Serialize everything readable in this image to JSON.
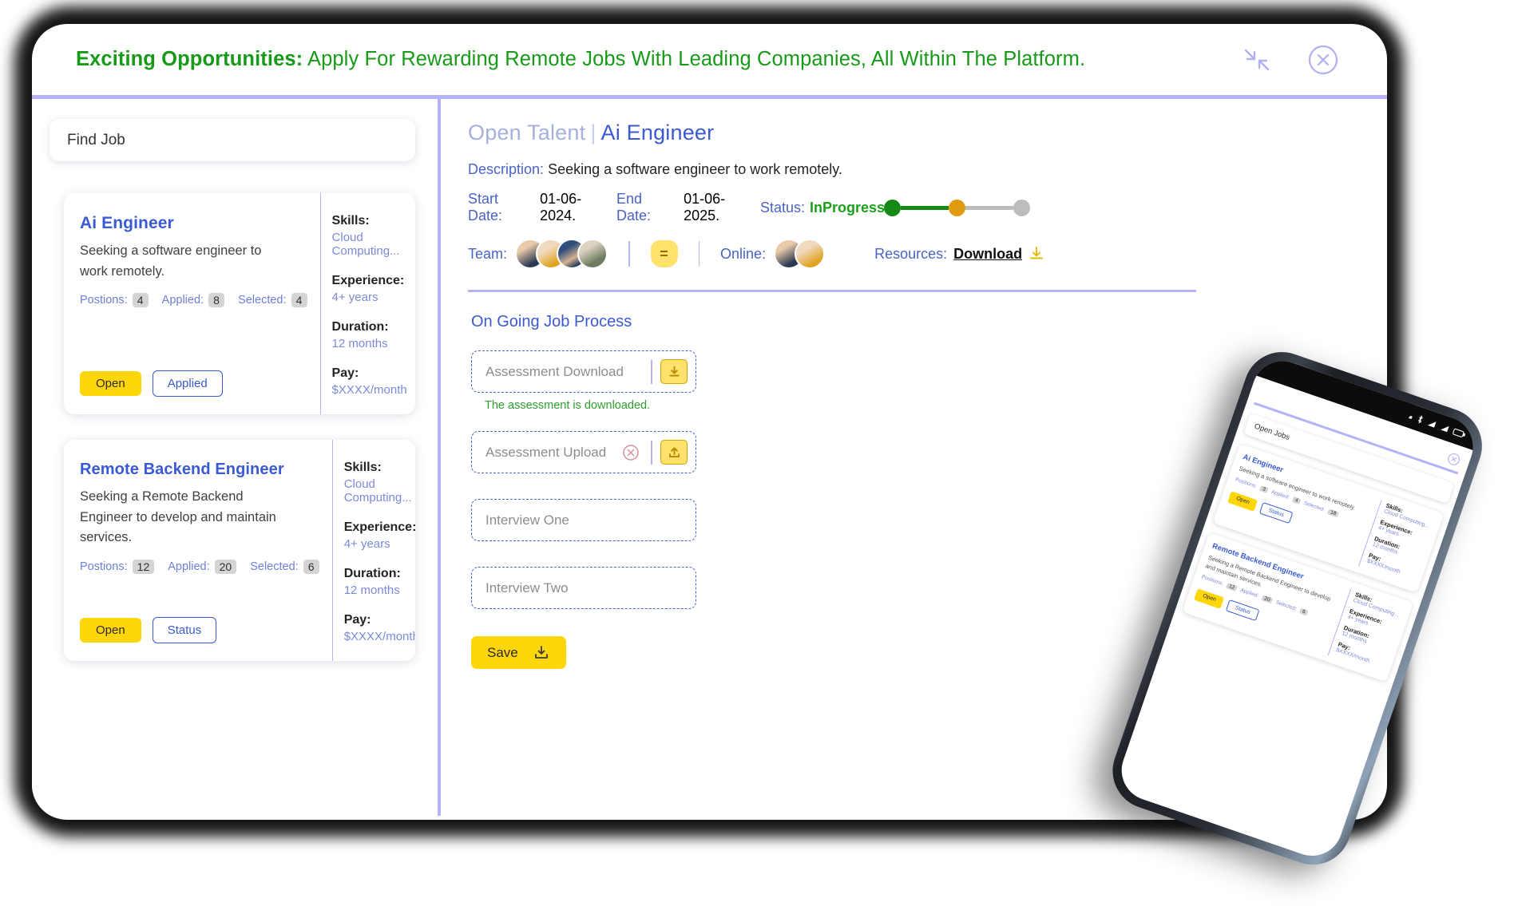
{
  "banner": {
    "title_bold": "Exciting Opportunities:",
    "title_rest": " Apply For Rewarding Remote Jobs With Leading Companies, All Within The Platform.",
    "accent_color": "#179a17",
    "minimize_icon": "collapse-arrows-icon",
    "close_icon": "close-circle-icon",
    "divider_color": "#b3b3f7"
  },
  "sidebar": {
    "search": {
      "value": "Find Job",
      "placeholder": "Find Job"
    },
    "labels": {
      "positions": "Postions:",
      "applied": "Applied:",
      "selected": "Selected:",
      "skills": "Skills:",
      "experience": "Experience:",
      "duration": "Duration:",
      "pay": "Pay:"
    },
    "jobs": [
      {
        "title": "Ai Engineer",
        "description": "Seeking a software engineer to work remotely.",
        "positions": "4",
        "applied": "8",
        "selected": "4",
        "primary_button": "Open",
        "secondary_button": "Applied",
        "skills": "Cloud Computing...",
        "experience": "4+ years",
        "duration": "12 months",
        "pay": "$XXXX/month"
      },
      {
        "title": "Remote Backend Engineer",
        "description": "Seeking a Remote Backend Engineer to develop and maintain services.",
        "positions": "12",
        "applied": "20",
        "selected": "6",
        "primary_button": "Open",
        "secondary_button": "Status",
        "skills": "Cloud Computing...",
        "experience": "4+ years",
        "duration": "12 months",
        "pay": "$XXXX/month"
      }
    ]
  },
  "detail": {
    "breadcrumb": "Open Talent",
    "separator": "|",
    "job_name": "Ai Engineer",
    "description_label": "Description:",
    "description_value": "Seeking a software engineer to work remotely.",
    "start_date_label": "Start Date:",
    "start_date_value": "01-06-2024.",
    "end_date_label": "End Date:",
    "end_date_value": "01-06-2025.",
    "status_label": "Status:",
    "status_value": "InProgress",
    "status_color": "#1aa01a",
    "stepper": {
      "step1_color": "#148a14",
      "line1_color": "#148a14",
      "step2_color": "#e09a11",
      "line2_color": "#bdbdbd",
      "step3_color": "#bdbdbd"
    },
    "team_label": "Team:",
    "online_label": "Online:",
    "equals_badge": "=",
    "resources_label": "Resources:",
    "resources_link": "Download",
    "resources_icon": "download-icon",
    "process_title": "On Going Job Process",
    "fields": [
      {
        "placeholder": "Assessment Download",
        "action_icon": "download-icon",
        "note": "The assessment is downloaded.",
        "has_clear": false
      },
      {
        "placeholder": "Assessment Upload",
        "action_icon": "upload-icon",
        "note": "",
        "has_clear": true
      },
      {
        "placeholder": "Interview One",
        "action_icon": "",
        "note": "",
        "has_clear": false
      },
      {
        "placeholder": "Interview Two",
        "action_icon": "",
        "note": "",
        "has_clear": false
      }
    ],
    "save_button": "Save",
    "save_icon": "save-download-icon"
  },
  "phone": {
    "close_icon": "close-circle-icon",
    "search_value": "Open Jobs",
    "labels": {
      "positions": "Positions:",
      "applied": "Applied:",
      "selected": "Selected:",
      "skills": "Skills:",
      "experience": "Experience:",
      "duration": "Duration:",
      "pay": "Pay:"
    },
    "jobs": [
      {
        "title": "Ai Engineer",
        "description": "Seeking a software engineer to work remotely.",
        "positions": "3",
        "applied": "4",
        "selected": "18",
        "primary_button": "Open",
        "secondary_button": "Status",
        "skills": "Cloud Computing...",
        "experience": "4+ years",
        "duration": "12 months",
        "pay": "$XXXX/month"
      },
      {
        "title": "Remote Backend Engineer",
        "description": "Seeking a Remote Backend Engineer to develop and maintain services.",
        "positions": "12",
        "applied": "20",
        "selected": "6",
        "primary_button": "Open",
        "secondary_button": "Status",
        "skills": "Cloud Computing...",
        "experience": "4+ years",
        "duration": "12 months",
        "pay": "$XXXX/month"
      }
    ],
    "status_icons": [
      "signal-icon",
      "bluetooth-icon",
      "wifi-icon",
      "cellular-icon",
      "battery-icon"
    ]
  }
}
